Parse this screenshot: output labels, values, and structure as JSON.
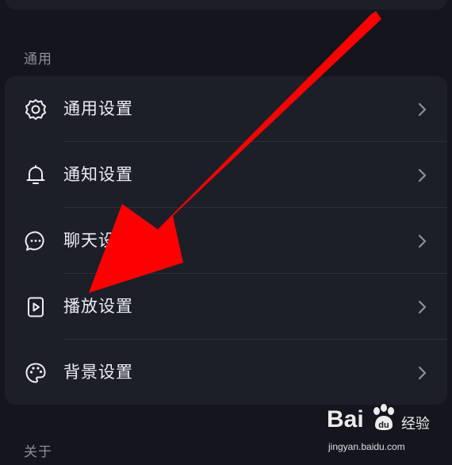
{
  "sections": {
    "general_label": "通用",
    "about_label": "关于"
  },
  "menu": {
    "items": [
      {
        "label": "通用设置",
        "icon": "gear-icon"
      },
      {
        "label": "通知设置",
        "icon": "bell-icon"
      },
      {
        "label": "聊天设置",
        "icon": "chat-bubble-icon"
      },
      {
        "label": "播放设置",
        "icon": "play-icon"
      },
      {
        "label": "背景设置",
        "icon": "palette-icon"
      }
    ]
  },
  "watermark": {
    "brand_left": "Bai",
    "brand_right": "经验",
    "url": "jingyan.baidu.com"
  },
  "colors": {
    "background": "#15161d",
    "card": "#1d1f28",
    "text": "#eceef3",
    "muted": "#8c8f9a",
    "annotation_arrow": "#ff0000"
  }
}
